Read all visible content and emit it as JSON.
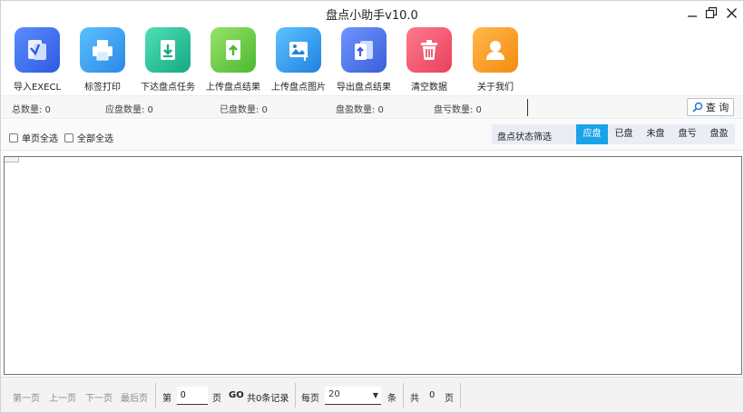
{
  "window": {
    "title": "盘点小助手v10.0"
  },
  "toolbar": [
    {
      "name": "import-excel-button",
      "label": "导入EXECL",
      "icon": "import-excel-icon",
      "color": "#3c6ff0"
    },
    {
      "name": "label-print-button",
      "label": "标签打印",
      "icon": "printer-icon",
      "color": "#3aa0ef"
    },
    {
      "name": "issue-task-button",
      "label": "下达盘点任务",
      "icon": "download-task-icon",
      "color": "#27c29a"
    },
    {
      "name": "upload-result-button",
      "label": "上传盘点结果",
      "icon": "upload-result-icon",
      "color": "#74cf4a"
    },
    {
      "name": "upload-image-button",
      "label": "上传盘点图片",
      "icon": "upload-image-icon",
      "color": "#2f9ff0"
    },
    {
      "name": "export-result-button",
      "label": "导出盘点结果",
      "icon": "export-result-icon",
      "color": "#4a74e8"
    },
    {
      "name": "clear-data-button",
      "label": "清空数据",
      "icon": "trash-icon",
      "color": "#f0506a"
    },
    {
      "name": "about-us-button",
      "label": "关于我们",
      "icon": "user-icon",
      "color": "#f79a1e"
    }
  ],
  "stats": {
    "total": "总数量: 0",
    "due": "应盘数量: 0",
    "done": "已盘数量: 0",
    "surplus": "盘盈数量: 0",
    "loss": "盘亏数量: 0"
  },
  "search": {
    "value": "",
    "button_label": "查 询"
  },
  "select": {
    "page_all": "单页全选",
    "all": "全部全选"
  },
  "filter": {
    "label": "盘点状态筛选",
    "tabs": [
      "应盘",
      "已盘",
      "未盘",
      "盘亏",
      "盘盈"
    ],
    "active": "应盘",
    "accent": "#1aa3e8"
  },
  "pager": {
    "first": "第一页",
    "prev": "上一页",
    "next": "下一页",
    "last": "最后页",
    "page_prefix": "第",
    "page_value": "0",
    "page_suffix": "页",
    "go": "GO",
    "records": "共0条记录",
    "per_page": "每页",
    "page_size": "20",
    "unit": "条",
    "total_prefix": "共",
    "total_pages": "0",
    "total_suffix": "页"
  }
}
